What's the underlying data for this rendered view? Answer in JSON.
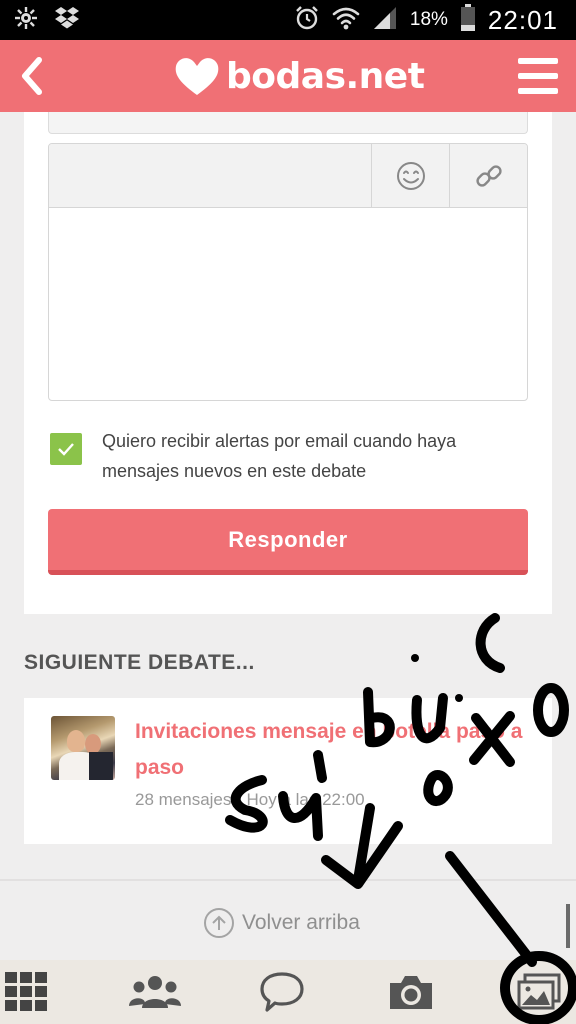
{
  "status_bar": {
    "battery_percent": "18%",
    "time": "22:01",
    "left_icons": [
      "settings-icon",
      "dropbox-icon"
    ],
    "right_icons": [
      "alarm-icon",
      "wifi-icon",
      "signal-icon",
      "battery-icon"
    ]
  },
  "header": {
    "logo_text": "bodas.net",
    "brand_color": "#f07075"
  },
  "form": {
    "toolbar_icons": [
      "emoji-icon",
      "link-icon"
    ],
    "editor_value": "",
    "alert_checkbox_checked": true,
    "alert_label": "Quiero recibir alertas por email cuando haya mensajes nuevos en este debate",
    "reply_button": "Responder"
  },
  "next_debate": {
    "section_title": "SIGUIENTE DEBATE...",
    "title": "Invitaciones mensaje en botella paso a paso",
    "meta": "28 mensajes · Hoy a las 22:00"
  },
  "footer": {
    "back_to_top": "Volver arriba"
  },
  "bottom_nav": {
    "items": [
      "grid-icon",
      "community-icon",
      "chat-icon",
      "camera-icon",
      "photos-icon"
    ]
  },
  "annotation_ink": {
    "color": "#000000"
  }
}
